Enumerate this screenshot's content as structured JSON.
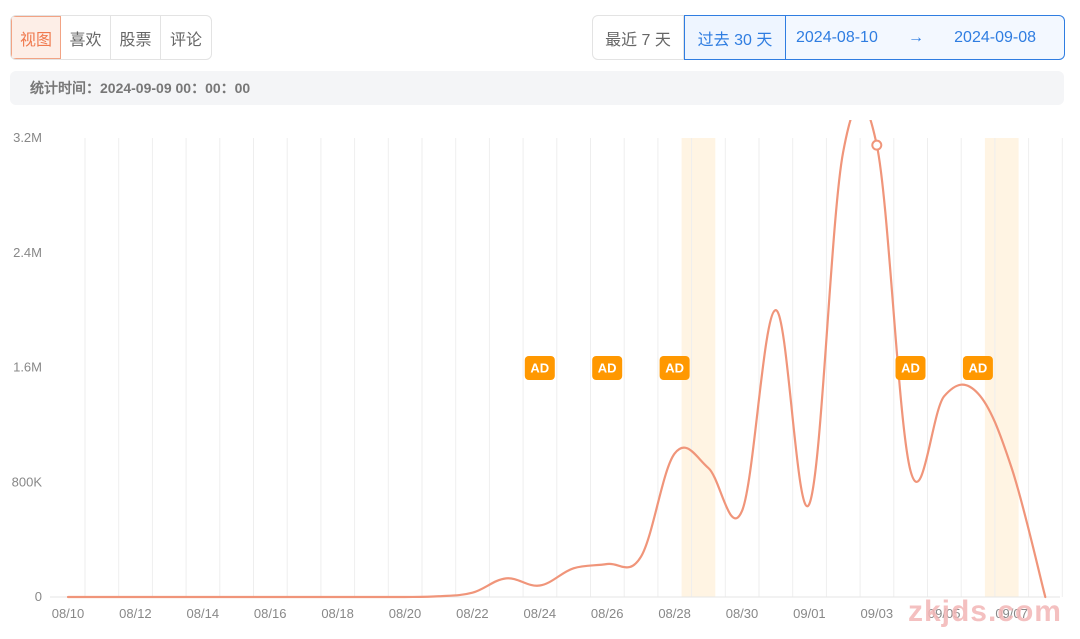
{
  "tabs": [
    {
      "label": "视图",
      "active": true
    },
    {
      "label": "喜欢",
      "active": false
    },
    {
      "label": "股票",
      "active": false
    },
    {
      "label": "评论",
      "active": false
    }
  ],
  "range": {
    "last7": "最近 7 天",
    "last30": "过去 30 天",
    "start_date": "2024-08-10",
    "arrow": "→",
    "end_date": "2024-09-08"
  },
  "stat_time": "统计时间：2024-09-09 00：00：00",
  "watermark": "zkjds.com",
  "colors": {
    "line": "#f0957a",
    "grid": "#eeeeee",
    "ad_badge": "#ff9800",
    "ad_band": "#fff4e3",
    "accent_blue": "#2f7de1",
    "accent_orange": "#f07a4f"
  },
  "chart_data": {
    "type": "line",
    "xlabel": "",
    "ylabel": "",
    "ylim": [
      0,
      3200000
    ],
    "yticks": [
      {
        "value": 0,
        "label": "0"
      },
      {
        "value": 800000,
        "label": "800K"
      },
      {
        "value": 1600000,
        "label": "1.6M"
      },
      {
        "value": 2400000,
        "label": "2.4M"
      },
      {
        "value": 3200000,
        "label": "3.2M"
      }
    ],
    "x": [
      "08/10",
      "08/11",
      "08/12",
      "08/13",
      "08/14",
      "08/15",
      "08/16",
      "08/17",
      "08/18",
      "08/19",
      "08/20",
      "08/21",
      "08/22",
      "08/23",
      "08/24",
      "08/25",
      "08/26",
      "08/27",
      "08/28",
      "08/29",
      "08/30",
      "08/31",
      "09/01",
      "09/02",
      "09/03",
      "09/04",
      "09/05",
      "09/06",
      "09/07",
      "09/08"
    ],
    "xtick_labels": [
      "08/10",
      "08/12",
      "08/14",
      "08/16",
      "08/18",
      "08/20",
      "08/22",
      "08/24",
      "08/26",
      "08/28",
      "08/30",
      "09/01",
      "09/03",
      "09/05",
      "09/07"
    ],
    "series": [
      {
        "values": [
          0,
          0,
          0,
          0,
          0,
          0,
          0,
          0,
          0,
          0,
          0,
          5000,
          30000,
          130000,
          80000,
          200000,
          230000,
          280000,
          1000000,
          900000,
          600000,
          2000000,
          650000,
          3100000,
          3150000,
          880000,
          1400000,
          1420000,
          900000,
          0
        ]
      }
    ],
    "highlight_point": {
      "x": "09/03",
      "value": 3150000
    },
    "ad_badges": [
      {
        "x": "08/24",
        "label": "AD"
      },
      {
        "x": "08/26",
        "label": "AD"
      },
      {
        "x": "08/28",
        "label": "AD"
      },
      {
        "x": "09/04",
        "label": "AD"
      },
      {
        "x": "09/06",
        "label": "AD"
      }
    ],
    "ad_bands": [
      "08/28",
      "09/06"
    ],
    "grid": true
  }
}
